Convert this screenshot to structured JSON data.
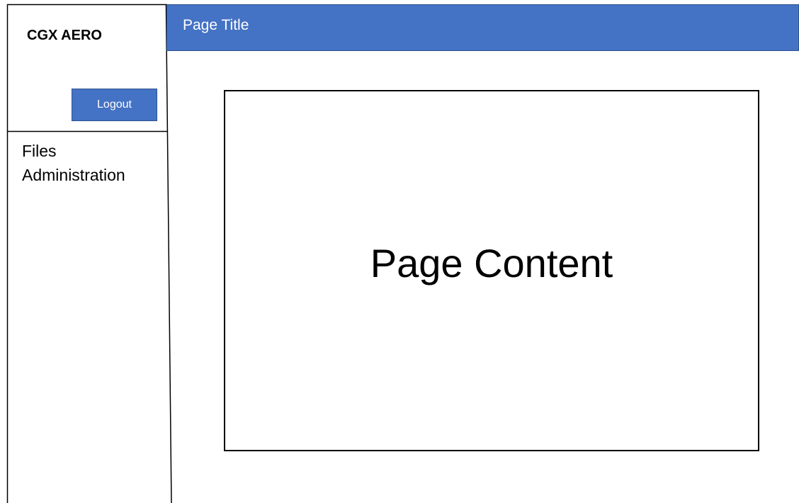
{
  "sidebar": {
    "brand": "CGX AERO",
    "logout_label": "Logout",
    "items": [
      {
        "label": "Files"
      },
      {
        "label": "Administration"
      }
    ]
  },
  "header": {
    "title": "Page Title"
  },
  "main": {
    "content_label": "Page Content"
  },
  "colors": {
    "accent": "#4472c4",
    "accent_border": "#2f528f"
  }
}
